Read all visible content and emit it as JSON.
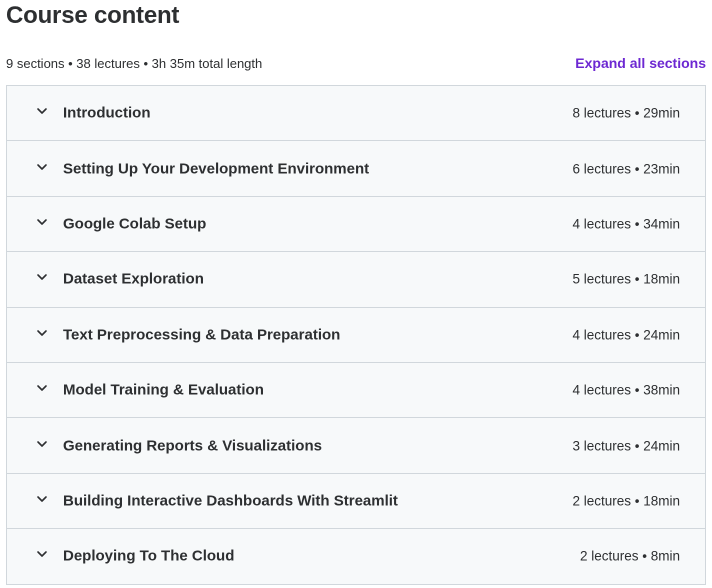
{
  "header": {
    "title": "Course content"
  },
  "summary": {
    "text": "9 sections • 38 lectures • 3h 35m total length",
    "expand_label": "Expand all sections"
  },
  "colors": {
    "accent": "#6d28d2",
    "section_bg": "#f7f9fa",
    "border": "#d1d7dc",
    "text": "#2d2f31"
  },
  "sections": [
    {
      "title": "Introduction",
      "meta": "8 lectures • 29min",
      "icon": "chevron-down-icon"
    },
    {
      "title": "Setting Up Your Development Environment",
      "meta": "6 lectures • 23min",
      "icon": "chevron-down-icon"
    },
    {
      "title": "Google Colab Setup",
      "meta": "4 lectures • 34min",
      "icon": "chevron-down-icon"
    },
    {
      "title": "Dataset Exploration",
      "meta": "5 lectures • 18min",
      "icon": "chevron-down-icon"
    },
    {
      "title": "Text Preprocessing & Data Preparation",
      "meta": "4 lectures • 24min",
      "icon": "chevron-down-icon"
    },
    {
      "title": "Model Training & Evaluation",
      "meta": "4 lectures • 38min",
      "icon": "chevron-down-icon"
    },
    {
      "title": "Generating Reports & Visualizations",
      "meta": "3 lectures • 24min",
      "icon": "chevron-down-icon"
    },
    {
      "title": "Building Interactive Dashboards With Streamlit",
      "meta": "2 lectures • 18min",
      "icon": "chevron-down-icon"
    },
    {
      "title": "Deploying To The Cloud",
      "meta": "2 lectures • 8min",
      "icon": "chevron-down-icon"
    }
  ]
}
